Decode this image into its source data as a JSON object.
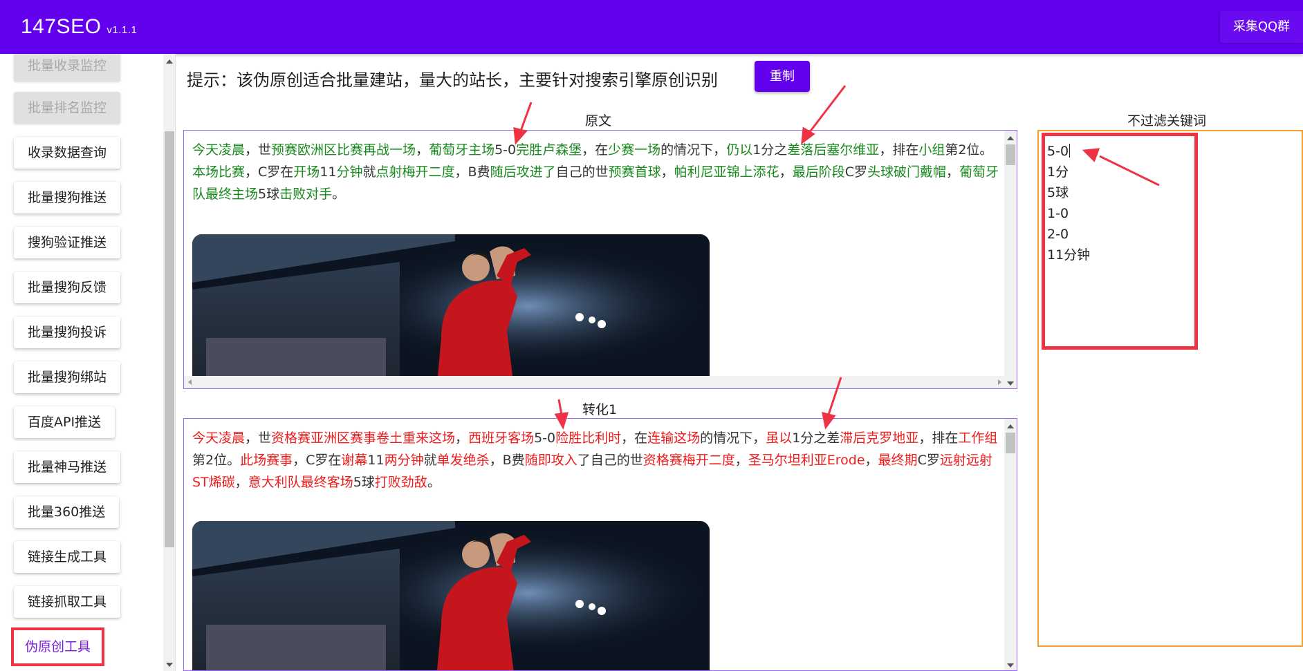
{
  "header": {
    "brand": "147SEO",
    "version": "v1.1.1",
    "qq_button": "采集QQ群",
    "bg_color": "#6200ee"
  },
  "sidebar": {
    "items": [
      {
        "label": "批量收录监控",
        "state": "disabled"
      },
      {
        "label": "批量排名监控",
        "state": "disabled"
      },
      {
        "label": "收录数据查询",
        "state": "normal"
      },
      {
        "label": "批量搜狗推送",
        "state": "normal"
      },
      {
        "label": "搜狗验证推送",
        "state": "normal"
      },
      {
        "label": "批量搜狗反馈",
        "state": "normal"
      },
      {
        "label": "批量搜狗投诉",
        "state": "normal"
      },
      {
        "label": "批量搜狗绑站",
        "state": "normal"
      },
      {
        "label": "百度API推送",
        "state": "normal"
      },
      {
        "label": "批量神马推送",
        "state": "normal"
      },
      {
        "label": "批量360推送",
        "state": "normal"
      },
      {
        "label": "链接生成工具",
        "state": "normal"
      },
      {
        "label": "链接抓取工具",
        "state": "normal"
      },
      {
        "label": "伪原创工具",
        "state": "active"
      }
    ]
  },
  "main": {
    "tip": "提示：该伪原创适合批量建站，量大的站长，主要针对搜索引擎原创识别",
    "reset_button": "重制",
    "original_label": "原文",
    "converted_label": "转化1",
    "keywords_label": "不过滤关键词",
    "original_segments": [
      {
        "t": "今天凌晨",
        "c": "g"
      },
      {
        "t": "，世",
        "c": ""
      },
      {
        "t": "预赛欧洲区比赛再战一场",
        "c": "g"
      },
      {
        "t": "，",
        "c": ""
      },
      {
        "t": "葡萄牙主场",
        "c": "g"
      },
      {
        "t": "5-0",
        "c": ""
      },
      {
        "t": "完胜卢森堡",
        "c": "g"
      },
      {
        "t": "，在",
        "c": ""
      },
      {
        "t": "少赛一场",
        "c": "g"
      },
      {
        "t": "的情况下，",
        "c": ""
      },
      {
        "t": "仍以",
        "c": "g"
      },
      {
        "t": "1分之",
        "c": ""
      },
      {
        "t": "差落后塞尔维亚",
        "c": "g"
      },
      {
        "t": "，排在",
        "c": ""
      },
      {
        "t": "小组",
        "c": "g"
      },
      {
        "t": "第2位。",
        "c": ""
      },
      {
        "t": "本场比赛",
        "c": "g"
      },
      {
        "t": "，C罗在",
        "c": ""
      },
      {
        "t": "开场",
        "c": "g"
      },
      {
        "t": "11",
        "c": ""
      },
      {
        "t": "分钟",
        "c": "g"
      },
      {
        "t": "就",
        "c": ""
      },
      {
        "t": "点射梅开二度",
        "c": "g"
      },
      {
        "t": "，B费",
        "c": ""
      },
      {
        "t": "随后攻进了",
        "c": "g"
      },
      {
        "t": "自己的世",
        "c": ""
      },
      {
        "t": "预赛首球",
        "c": "g"
      },
      {
        "t": "，",
        "c": ""
      },
      {
        "t": "帕利尼亚锦上添花",
        "c": "g"
      },
      {
        "t": "，",
        "c": ""
      },
      {
        "t": "最后阶段",
        "c": "g"
      },
      {
        "t": "C罗",
        "c": ""
      },
      {
        "t": "头球破门戴帽",
        "c": "g"
      },
      {
        "t": "，",
        "c": ""
      },
      {
        "t": "葡萄牙队最终主场",
        "c": "g"
      },
      {
        "t": "5球",
        "c": ""
      },
      {
        "t": "击败对手",
        "c": "g"
      },
      {
        "t": "。",
        "c": ""
      }
    ],
    "converted_segments": [
      {
        "t": "今天凌晨",
        "c": "r"
      },
      {
        "t": "，世",
        "c": ""
      },
      {
        "t": "资格赛亚洲区赛事卷土重来这场",
        "c": "r"
      },
      {
        "t": "，",
        "c": ""
      },
      {
        "t": "西班牙客场",
        "c": "r"
      },
      {
        "t": "5-0",
        "c": ""
      },
      {
        "t": "险胜比利时",
        "c": "r"
      },
      {
        "t": "，在",
        "c": ""
      },
      {
        "t": "连输这场",
        "c": "r"
      },
      {
        "t": "的情况下，",
        "c": ""
      },
      {
        "t": "虽以",
        "c": "r"
      },
      {
        "t": "1分之差",
        "c": ""
      },
      {
        "t": "滞后克罗地亚",
        "c": "r"
      },
      {
        "t": "，排在",
        "c": ""
      },
      {
        "t": "工作组",
        "c": "r"
      },
      {
        "t": "第2位。",
        "c": ""
      },
      {
        "t": "此场赛事",
        "c": "r"
      },
      {
        "t": "，C罗在",
        "c": ""
      },
      {
        "t": "谢幕",
        "c": "r"
      },
      {
        "t": "11",
        "c": ""
      },
      {
        "t": "两分钟",
        "c": "r"
      },
      {
        "t": "就",
        "c": ""
      },
      {
        "t": "单发绝杀",
        "c": "r"
      },
      {
        "t": "，B费",
        "c": ""
      },
      {
        "t": "随即攻入",
        "c": "r"
      },
      {
        "t": "了自己的世",
        "c": ""
      },
      {
        "t": "资格赛梅开二度",
        "c": "r"
      },
      {
        "t": "，",
        "c": ""
      },
      {
        "t": "圣马尔坦利亚Erode",
        "c": "r"
      },
      {
        "t": "，",
        "c": ""
      },
      {
        "t": "最终期",
        "c": "r"
      },
      {
        "t": "C罗",
        "c": ""
      },
      {
        "t": "远射远射ST烯碳",
        "c": "r"
      },
      {
        "t": "，",
        "c": ""
      },
      {
        "t": "意大利队最终客场",
        "c": "r"
      },
      {
        "t": "5球",
        "c": ""
      },
      {
        "t": "打败劲敌",
        "c": "r"
      },
      {
        "t": "。",
        "c": ""
      }
    ],
    "keywords": [
      "5-0",
      "1分",
      "5球",
      "1-0",
      "2-0",
      "11分钟"
    ]
  },
  "colors": {
    "accent": "#6200ee",
    "original_highlight": "#198a1e",
    "converted_highlight": "#ee1c1c",
    "annotation": "#ee3344"
  }
}
